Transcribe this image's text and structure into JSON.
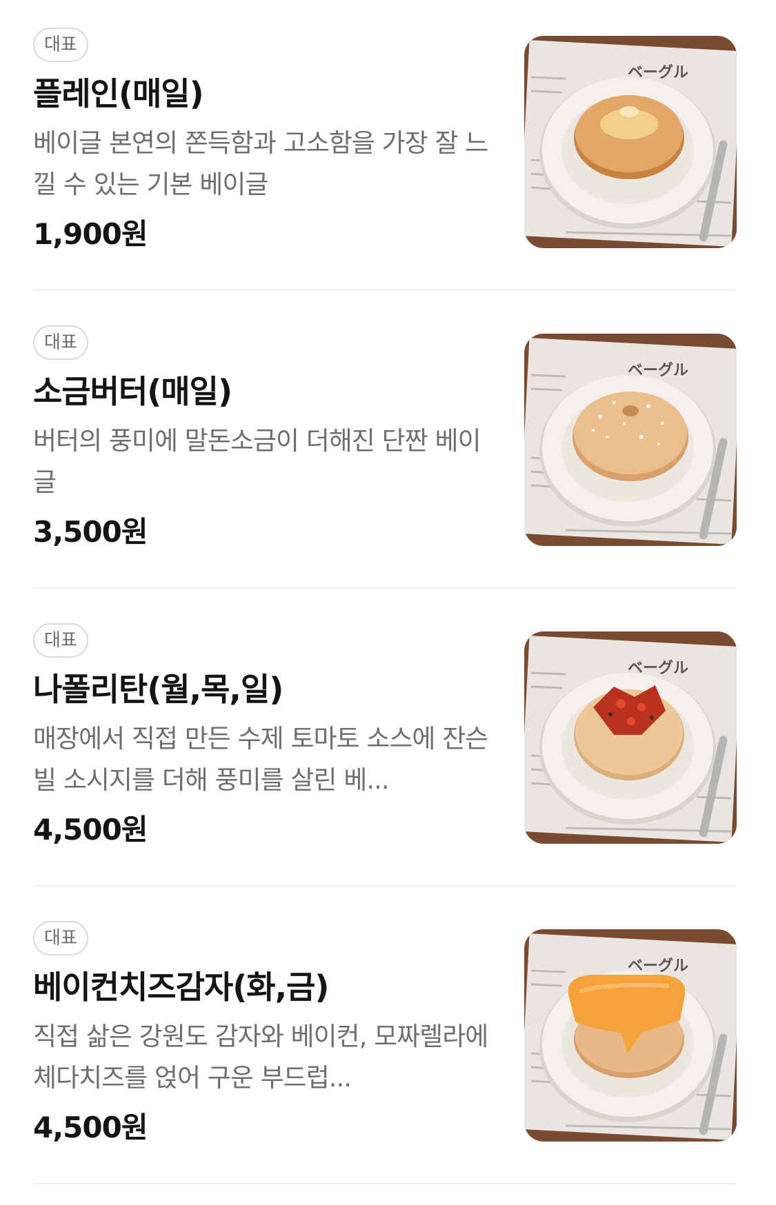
{
  "menu": {
    "items": [
      {
        "badge": "대표",
        "name": "플레인(매일)",
        "description": "베이글 본연의 쫀득함과 고소함을 가장 잘 느낄 수 있는 기본 베이글",
        "price": "1,900원",
        "photo": "plain-bagel"
      },
      {
        "badge": "대표",
        "name": "소금버터(매일)",
        "description": "버터의 풍미에 말돈소금이 더해진 단짠 베이글",
        "price": "3,500원",
        "photo": "salt-butter-bagel"
      },
      {
        "badge": "대표",
        "name": "나폴리탄(월,목,일)",
        "description": "매장에서 직접 만든 수제 토마토 소스에 잔슨빌 소시지를 더해 풍미를 살린 베...",
        "price": "4,500원",
        "photo": "napolitan-bagel"
      },
      {
        "badge": "대표",
        "name": "베이컨치즈감자(화,금)",
        "description": "직접 삶은 강원도 감자와 베이컨, 모짜렐라에 체다치즈를 얹어 구운 부드럽...",
        "price": "4,500원",
        "photo": "bacon-cheese-potato-bagel"
      }
    ]
  },
  "colors": {
    "title": "#141414",
    "description": "#6e6e6e",
    "badge_border": "#d9d9d9",
    "divider": "#eeeeee",
    "table_wood": "#8a5a3b",
    "newspaper": "#e9e6e1",
    "plate": "#f4f1ec",
    "bagel": "#e3a867",
    "tomato": "#b8321f",
    "cheddar": "#f4a23a"
  }
}
